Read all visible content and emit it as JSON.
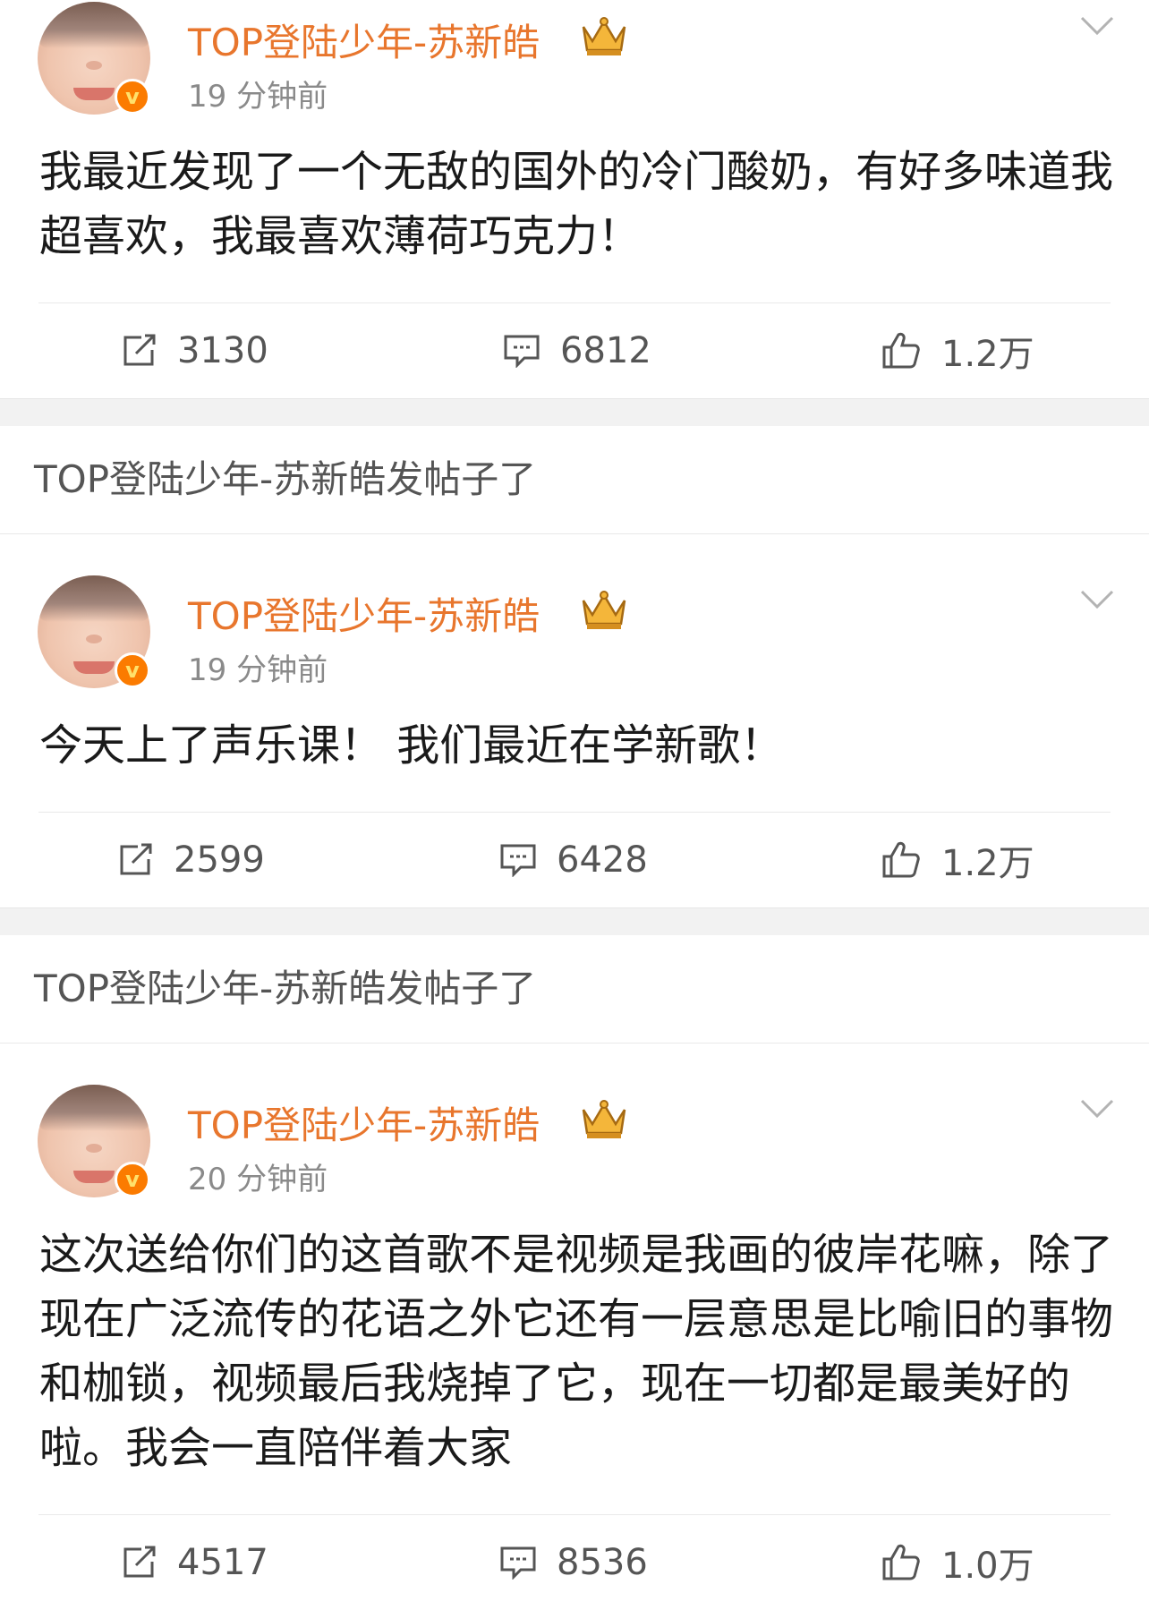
{
  "feed": {
    "notice_text": "TOP登陆少年-苏新皓发帖子了",
    "posts": [
      {
        "username": "TOP登陆少年-苏新皓",
        "time": "19 分钟前",
        "text": "我最近发现了一个无敌的国外的冷门酸奶，有好多味道我超喜欢，我最喜欢薄荷巧克力！",
        "reposts": "3130",
        "comments": "6812",
        "likes": "1.2万"
      },
      {
        "username": "TOP登陆少年-苏新皓",
        "time": "19 分钟前",
        "text": "今天上了声乐课！ 我们最近在学新歌！",
        "reposts": "2599",
        "comments": "6428",
        "likes": "1.2万"
      },
      {
        "username": "TOP登陆少年-苏新皓",
        "time": "20 分钟前",
        "text": "这次送给你们的这首歌不是视频是我画的彼岸花嘛，除了现在广泛流传的花语之外它还有一层意思是比喻旧的事物和枷锁，视频最后我烧掉了它，现在一切都是最美好的啦。我会一直陪伴着大家",
        "reposts": "4517",
        "comments": "8536",
        "likes": "1.0万"
      }
    ]
  },
  "colors": {
    "username": "#e8762d",
    "verified_badge": "#fb7b00",
    "separator": "#f2f2f2"
  },
  "icons": {
    "verified": "v-badge-icon",
    "crown": "crown-icon",
    "more": "chevron-down-icon",
    "repost": "repost-icon",
    "comment": "comment-icon",
    "like": "thumbs-up-icon"
  }
}
